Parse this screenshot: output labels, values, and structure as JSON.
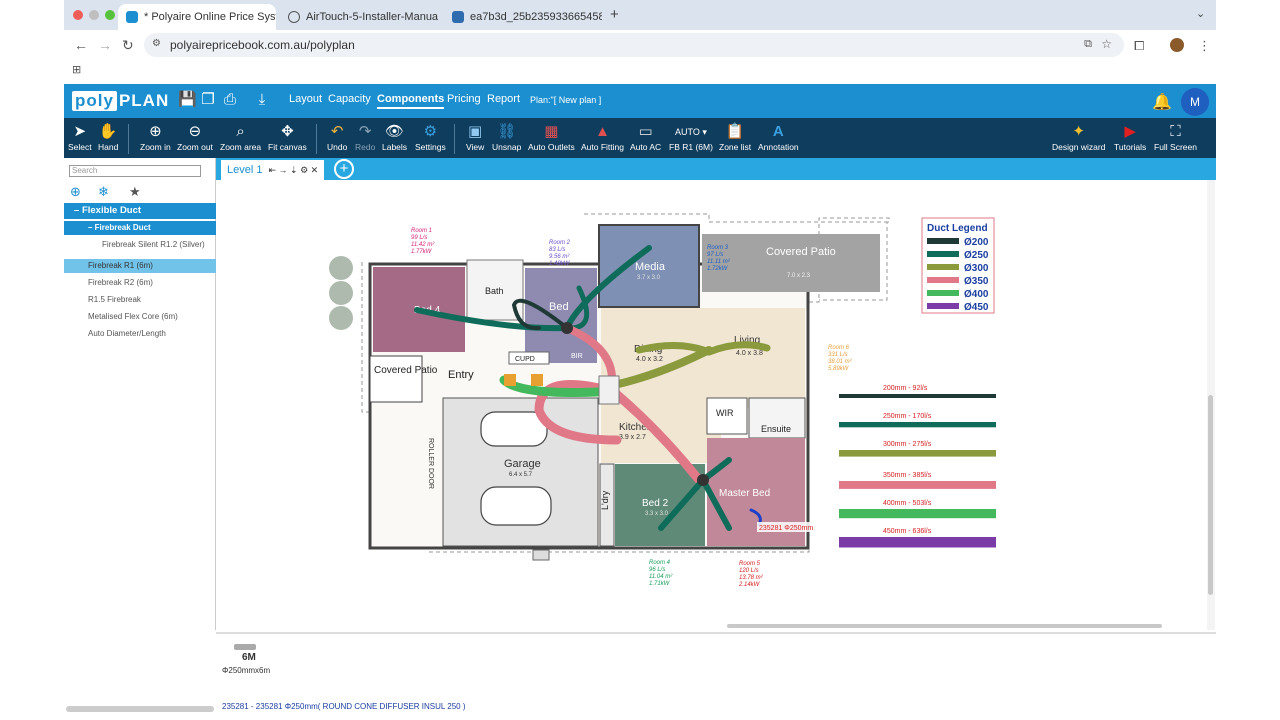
{
  "browser": {
    "tabs": [
      {
        "title": "* Polyaire Online Price System",
        "active": true
      },
      {
        "title": "AirTouch-5-Installer-Manual.p",
        "active": false
      },
      {
        "title": "ea7b3d_25b235933665458",
        "active": false
      }
    ],
    "url": "polyairepricebook.com.au/polyplan"
  },
  "app": {
    "logo_poly": "poly",
    "logo_plan": "PLAN",
    "menu": [
      "Layout",
      "Capacity",
      "Components",
      "Pricing",
      "Report"
    ],
    "active_menu": "Components",
    "plan_name": "Plan:\"[ New plan ]",
    "avatar": "M"
  },
  "toolbar": {
    "tools": [
      "Select",
      "Hand",
      "Zoom in",
      "Zoom out",
      "Zoom area",
      "Fit canvas",
      "Undo",
      "Redo",
      "Labels",
      "Settings",
      "View",
      "Unsnap",
      "Auto Outlets",
      "Auto Fitting",
      "Auto AC",
      "FB R1 (6M)",
      "Zone list",
      "Annotation"
    ],
    "right_tools": [
      "Design wizard",
      "Tutorials",
      "Full Screen"
    ]
  },
  "sidebar": {
    "search_placeholder": "Search",
    "category": "Flexible Duct",
    "subcategory": "Firebreak Duct",
    "items": [
      "Firebreak Silent R1.2 (Silver)",
      "Firebreak R1 (6m)",
      "Firebreak R2 (6m)",
      "R1.5 Firebreak",
      "Metalised Flex Core (6m)",
      "Auto Diameter/Length"
    ],
    "selected": "Firebreak R1 (6m)"
  },
  "levels": {
    "current": "Level 1",
    "controls": "⇤ → ⇣ ⚙ ✕"
  },
  "plan": {
    "rooms": {
      "bed4": "Bed 4",
      "bath": "Bath",
      "bed3": "Bed",
      "media": "Media",
      "media_dim": "3.7 x 3.0",
      "covered_patio": "Covered Patio",
      "covered_patio_dim": "7.0 x 2.3",
      "covered_patio_2": "Covered Patio",
      "entry": "Entry",
      "cupd": "CUPD",
      "bir": "BIR",
      "dining": "Dining",
      "dining_dim": "4.0 x 3.2",
      "living": "Living",
      "living_dim": "4.0 x 3.8",
      "kitchen": "Kitchen",
      "kitchen_dim": "3.9 x 2.7",
      "wir": "WIR",
      "ensuite": "Ensuite",
      "garage": "Garage",
      "garage_dim": "6.4 x 5.7",
      "roller_door": "ROLLER DOOR",
      "ldry": "L'dry",
      "bed2": "Bed 2",
      "bed2_dim": "3.3 x 3.0",
      "master_bed": "Master Bed"
    },
    "zone_labels": [
      {
        "name": "Room 1",
        "flow": "99 L/s",
        "area": "11.42 m²",
        "kw": "1.77kW",
        "color": "#d4237a"
      },
      {
        "name": "Room 2",
        "flow": "83 L/s",
        "area": "9.56 m²",
        "kw": "1.48kW",
        "color": "#6b4fc8"
      },
      {
        "name": "Room 3",
        "flow": "97 L/s",
        "area": "11.11 m²",
        "kw": "1.72kW",
        "color": "#1b5fc8"
      },
      {
        "name": "Room 6",
        "flow": "331 L/s",
        "area": "38.01 m²",
        "kw": "5.89kW",
        "color": "#e8a040"
      },
      {
        "name": "Room 4",
        "flow": "96 L/s",
        "area": "11.04 m²",
        "kw": "1.71kW",
        "color": "#1a9c5a"
      },
      {
        "name": "Room 5",
        "flow": "120 L/s",
        "area": "13.78 m²",
        "kw": "2.14kW",
        "color": "#d42323"
      }
    ],
    "selected_tag": "235281 Φ250mm"
  },
  "legend": {
    "title": "Duct Legend",
    "items": [
      {
        "label": "Ø200",
        "color": "#1f3a36"
      },
      {
        "label": "Ø250",
        "color": "#0f6b5a"
      },
      {
        "label": "Ø300",
        "color": "#8a9a3c"
      },
      {
        "label": "Ø350",
        "color": "#e07888"
      },
      {
        "label": "Ø400",
        "color": "#44b85c"
      },
      {
        "label": "Ø450",
        "color": "#7c3ca8"
      }
    ]
  },
  "duct_samples": [
    {
      "label": "200mm - 92l/s",
      "color": "#1f3a36"
    },
    {
      "label": "250mm - 170l/s",
      "color": "#0f6b5a"
    },
    {
      "label": "300mm - 275l/s",
      "color": "#8a9a3c"
    },
    {
      "label": "350mm - 385l/s",
      "color": "#e07888"
    },
    {
      "label": "400mm - 503l/s",
      "color": "#44b85c"
    },
    {
      "label": "450mm - 636l/s",
      "color": "#7c3ca8"
    }
  ],
  "bottom": {
    "item_length": "6M",
    "item_label": "Φ250mmx6m",
    "status": "235281 - 235281 Φ250mm( ROUND CONE DIFFUSER INSUL 250 )"
  }
}
